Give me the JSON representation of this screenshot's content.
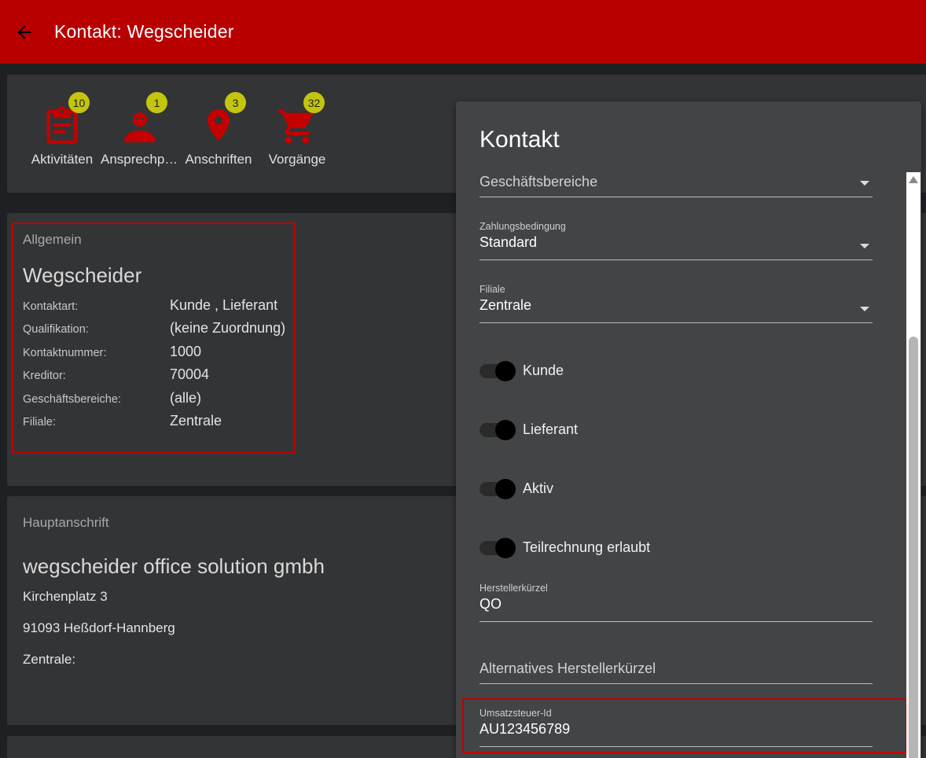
{
  "appbar": {
    "title": "Kontakt: Wegscheider",
    "back_icon": "arrow-left-icon",
    "color": "#b80000"
  },
  "quick_actions": [
    {
      "label": "Aktivitäten",
      "badge": "10",
      "icon": "clipboard-icon"
    },
    {
      "label": "Ansprechpartner",
      "badge": "1",
      "icon": "person-icon"
    },
    {
      "label": "Anschriften",
      "badge": "3",
      "icon": "map-pin-icon"
    },
    {
      "label": "Vorgänge",
      "badge": "32",
      "icon": "shopping-cart-icon"
    }
  ],
  "general": {
    "section": "Allgemein",
    "name": "Wegscheider",
    "rows": [
      {
        "key": "Kontaktart:",
        "value": "Kunde , Lieferant"
      },
      {
        "key": "Qualifikation:",
        "value": "(keine Zuordnung)"
      },
      {
        "key": "Kontaktnummer:",
        "value": "1000"
      },
      {
        "key": "Kreditor:",
        "value": "70004"
      },
      {
        "key": "Geschäftsbereiche:",
        "value": "(alle)"
      },
      {
        "key": "Filiale:",
        "value": "Zentrale"
      }
    ]
  },
  "address": {
    "section": "Hauptanschrift",
    "company": "wegscheider office solution gmbh",
    "street": "Kirchenplatz 3",
    "city": "91093 Heßdorf-Hannberg",
    "branch": "Zentrale:"
  },
  "panel": {
    "title": "Kontakt",
    "business_areas": {
      "placeholder": "Geschäftsbereiche"
    },
    "payment_terms": {
      "label": "Zahlungsbedingung",
      "value": "Standard"
    },
    "branch": {
      "label": "Filiale",
      "value": "Zentrale"
    },
    "toggles": [
      {
        "label": "Kunde",
        "on": true
      },
      {
        "label": "Lieferant",
        "on": true
      },
      {
        "label": "Aktiv",
        "on": true
      },
      {
        "label": "Teilrechnung erlaubt",
        "on": true
      }
    ],
    "manufacturer_code": {
      "label": "Herstellerkürzel",
      "value": "QO"
    },
    "alt_manufacturer_code": {
      "placeholder": "Alternatives Herstellerkürzel"
    },
    "vat_id": {
      "label": "Umsatzsteuer-Id",
      "value": "AU123456789"
    }
  },
  "colors": {
    "accent": "#b80000",
    "badge": "#c3c50e",
    "highlight": "#c00000"
  }
}
